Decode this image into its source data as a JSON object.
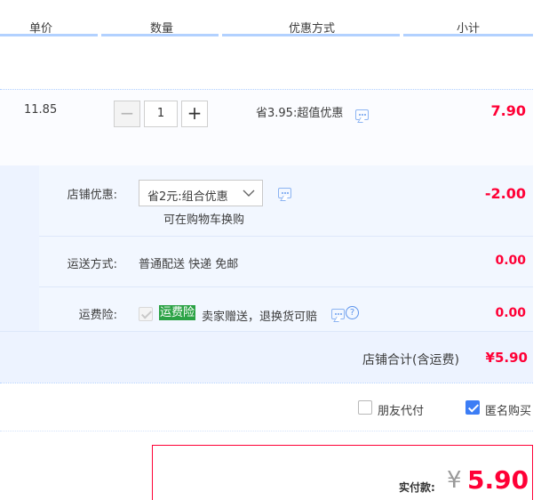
{
  "header": {
    "col_price": "单价",
    "col_qty": "数量",
    "col_discount": "优惠方式",
    "col_subtotal": "小计"
  },
  "item": {
    "unit_price": "11.85",
    "quantity": "1",
    "minus_label": "−",
    "plus_label": "+",
    "discount_text": "省3.95:超值优惠",
    "subtotal": "7.90"
  },
  "shop": {
    "promo_label": "店铺优惠:",
    "promo_selected": "省2元:组合优惠",
    "promo_note": "可在购物车换购",
    "promo_amount": "-2.00",
    "shipping_label": "运送方式:",
    "shipping_value": "普通配送 快递 免邮",
    "shipping_amount": "0.00",
    "insurance_label": "运费险:",
    "insurance_tag": "运费险",
    "insurance_desc": "卖家赠送，退换货可赔",
    "insurance_amount": "0.00",
    "help_glyph": "?",
    "total_label": "店铺合计(含运费)",
    "total_value": "¥5.90"
  },
  "options": {
    "friend_pay": "朋友代付",
    "anonymous": "匿名购买",
    "anonymous_checked": true,
    "friend_pay_checked": false
  },
  "payment": {
    "label": "实付款:",
    "currency": "¥",
    "amount": "5.90"
  },
  "colors": {
    "accent_red": "#ff0036",
    "header_line": "#b2d1ff",
    "section_bg": "#edf3ff",
    "checkbox_blue": "#3c7df5",
    "tag_green": "#2ba245"
  }
}
